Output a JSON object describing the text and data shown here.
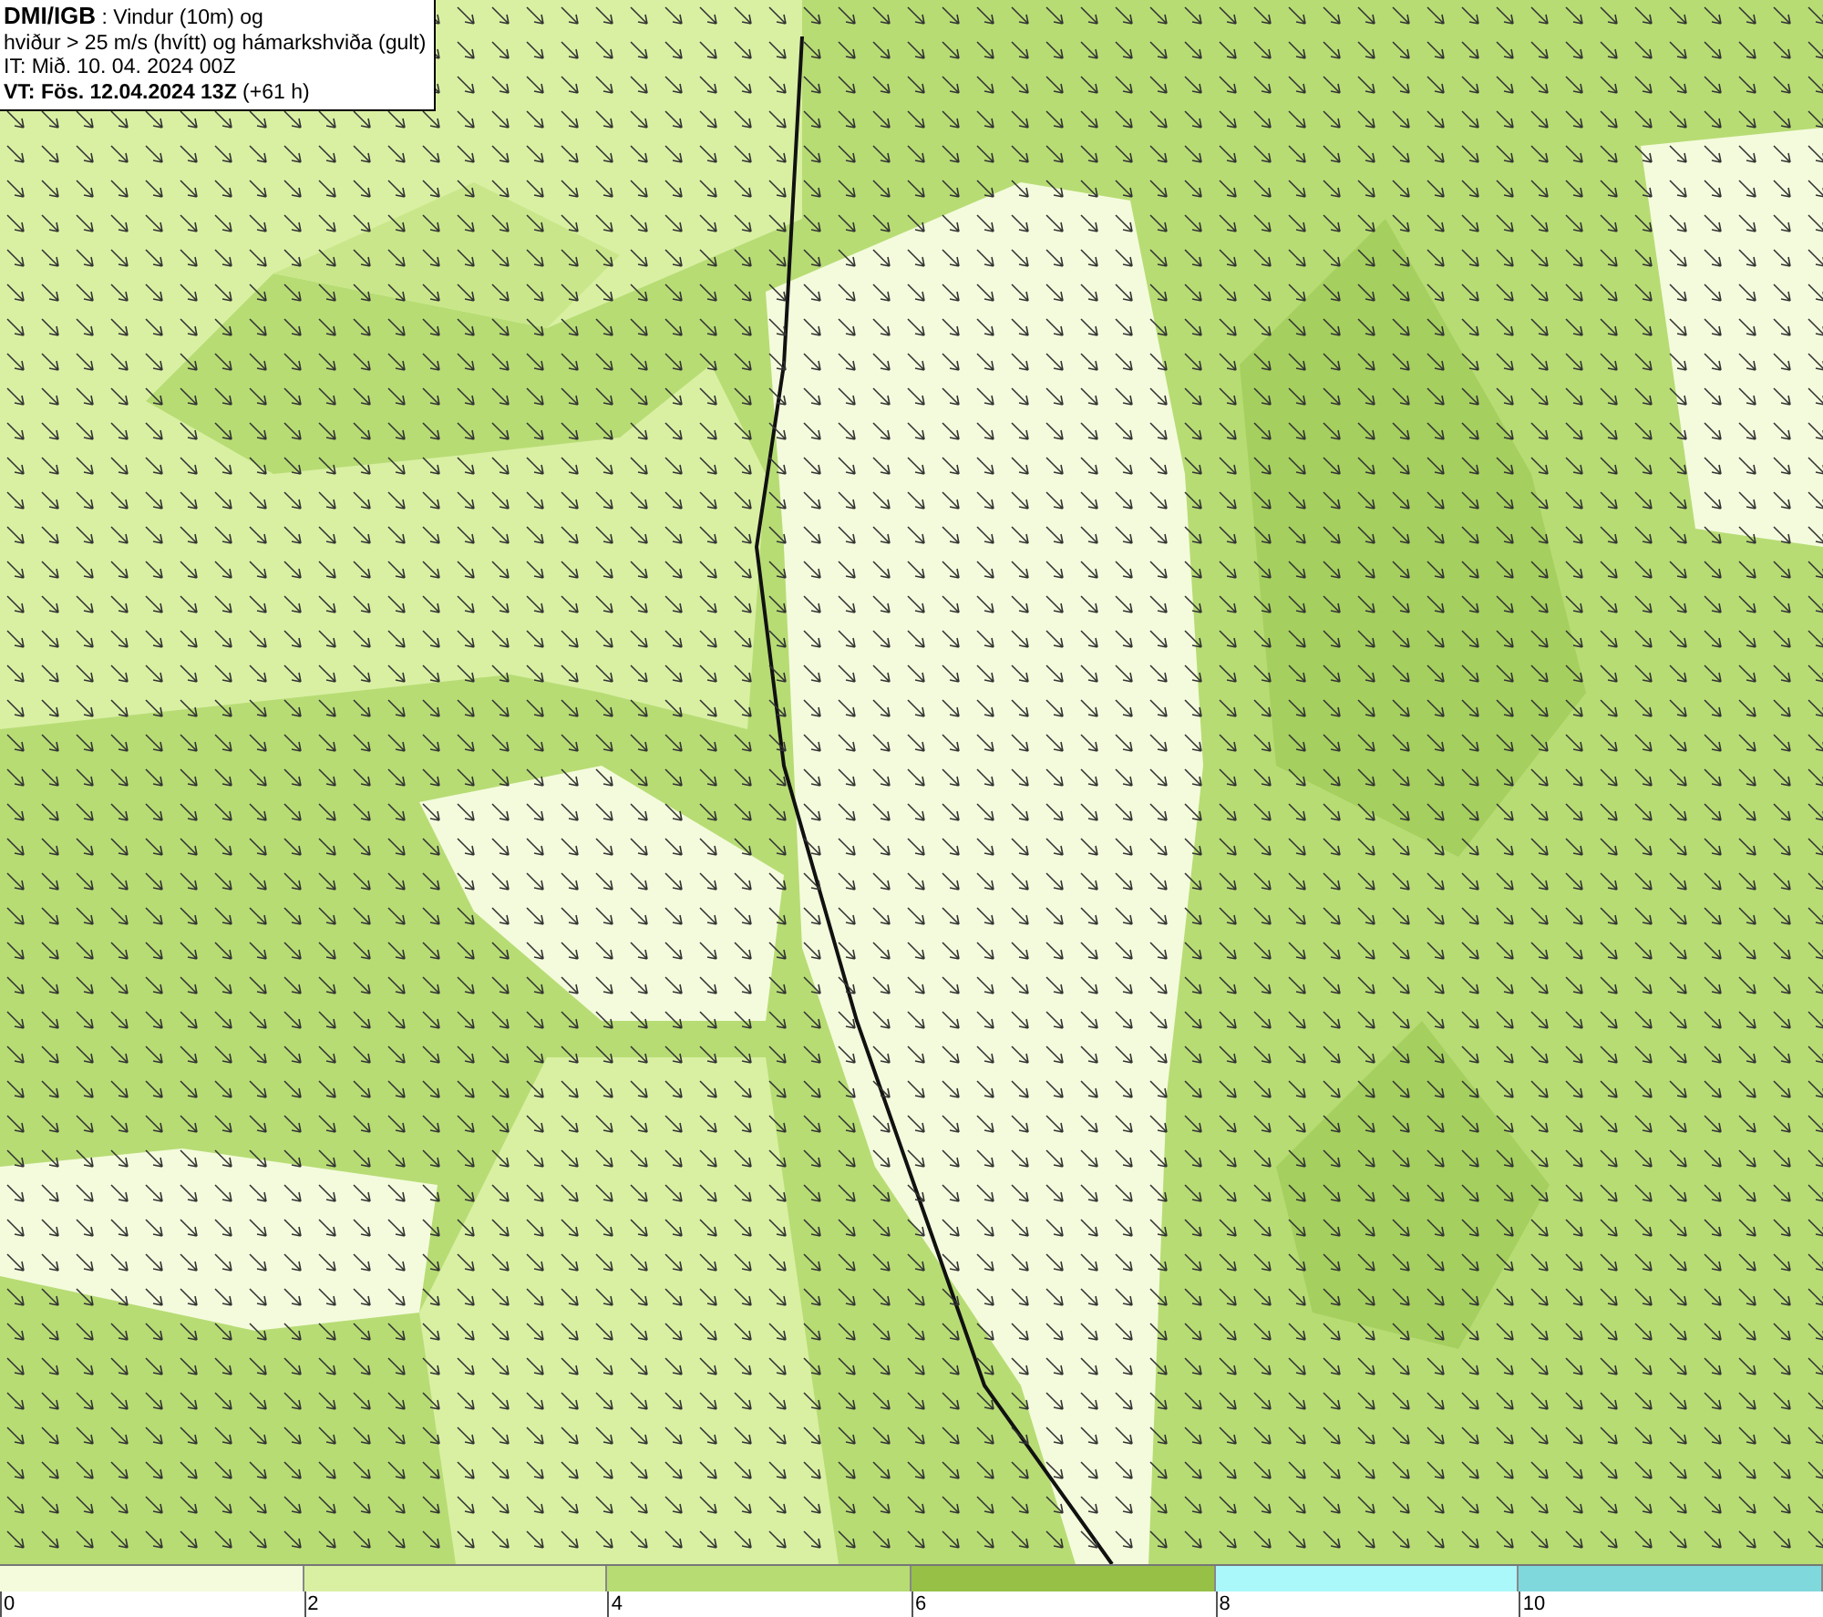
{
  "title_box": {
    "source": "DMI/IGB",
    "subtitle": " : Vindur (10m) og",
    "line_2": "hviður > 25 m/s (hvítt) og hámarkshviða (gult)",
    "initial_time": "IT: Mið. 10. 04. 2024 00Z",
    "valid_time": "VT: Fös. 12.04.2024 13Z",
    "lead_time": " (+61 h)"
  },
  "legend": {
    "segments": [
      {
        "color": "#f4fbdc"
      },
      {
        "color": "#d9f0a3"
      },
      {
        "color": "#b7dc74"
      },
      {
        "color": "#96c146"
      },
      {
        "color": "#aaf8fa"
      },
      {
        "color": "#7fd8dc"
      }
    ],
    "ticks": [
      "0",
      "2",
      "4",
      "6",
      "8",
      "10"
    ]
  }
}
